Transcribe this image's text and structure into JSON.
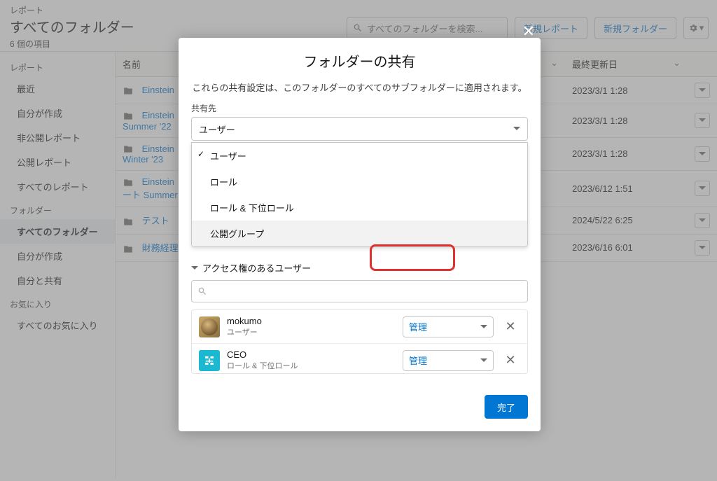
{
  "header": {
    "breadcrumb": "レポート",
    "title": "すべてのフォルダー",
    "count": "6 個の項目",
    "search_placeholder": "すべてのフォルダーを検索...",
    "new_report": "新規レポート",
    "new_folder": "新規フォルダー"
  },
  "sidebar": {
    "section1": "レポート",
    "items1": [
      "最近",
      "自分が作成",
      "非公開レポート",
      "公開レポート",
      "すべてのレポート"
    ],
    "section2": "フォルダー",
    "items2": [
      "すべてのフォルダー",
      "自分が作成",
      "自分と共有"
    ],
    "section3": "お気に入り",
    "items3": [
      "すべてのお気に入り"
    ]
  },
  "table": {
    "col_name": "名前",
    "col_date": "最終更新日",
    "rows": [
      {
        "name": "Einstein",
        "sub": "",
        "date": "2023/3/1 1:28"
      },
      {
        "name": "Einstein",
        "sub": "Summer '22",
        "date": "2023/3/1 1:28"
      },
      {
        "name": "Einstein",
        "sub": "Winter '23",
        "date": "2023/3/1 1:28"
      },
      {
        "name": "Einstein",
        "sub": "ート Summer",
        "date": "2023/6/12 1:51"
      },
      {
        "name": "テスト",
        "sub": "",
        "date": "2024/5/22 6:25"
      },
      {
        "name": "財務経理",
        "sub": "",
        "date": "2023/6/16 6:01"
      }
    ]
  },
  "modal": {
    "title": "フォルダーの共有",
    "desc": "これらの共有設定は、このフォルダーのすべてのサブフォルダーに適用されます。",
    "share_label": "共有先",
    "share_value": "ユーザー",
    "options": [
      "ユーザー",
      "ロール",
      "ロール & 下位ロール",
      "公開グループ"
    ],
    "access_heading": "アクセス権のあるユーザー",
    "users": [
      {
        "name": "mokumo",
        "type": "ユーザー",
        "perm": "管理",
        "avatar": "photo"
      },
      {
        "name": "CEO",
        "type": "ロール & 下位ロール",
        "perm": "管理",
        "avatar": "role"
      }
    ],
    "done": "完了"
  }
}
